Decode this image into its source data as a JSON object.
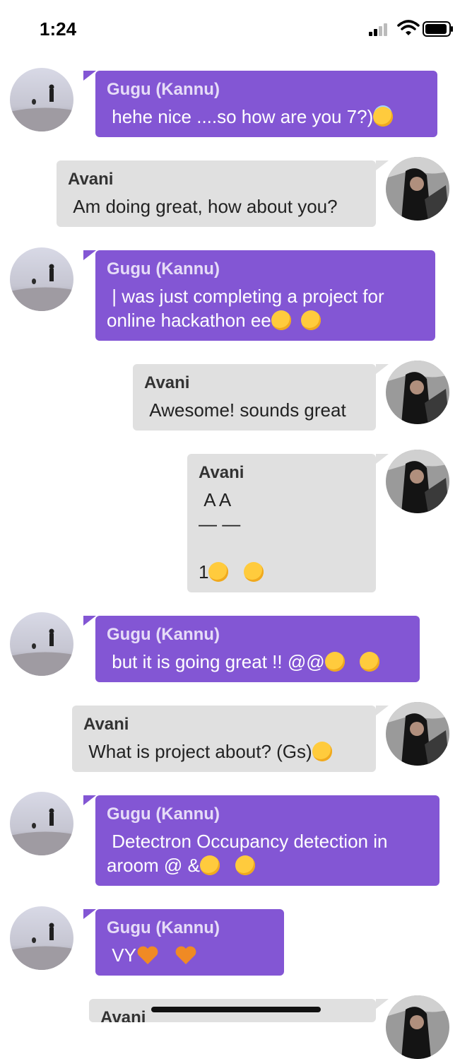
{
  "status_bar": {
    "time": "1:24"
  },
  "chat": {
    "messages": [
      {
        "sender": "Gugu (Kannu)",
        "text": " hehe nice ....so how are you 7?)",
        "emojis": [
          "halo-face"
        ]
      },
      {
        "sender": "Avani",
        "text": " Am doing great, how about you?",
        "emojis": []
      },
      {
        "sender": "Gugu (Kannu)",
        "text": " | was just completing a project for\nonline hackathon ee",
        "emojis": [
          "grimace-face",
          "grimace-face"
        ]
      },
      {
        "sender": "Avani",
        "text": " Awesome! sounds great",
        "emojis": []
      },
      {
        "sender": "Avani",
        "text": " A A\n— —\n\n1",
        "emojis": [
          "smile-face",
          "smile-face"
        ]
      },
      {
        "sender": "Gugu (Kannu)",
        "text": " but it is going great !! @@",
        "emojis": [
          "heart-eyes-face",
          "kissing-face"
        ]
      },
      {
        "sender": "Avani",
        "text": " What is project about? (Gs)",
        "emojis": [
          "surprised-face"
        ]
      },
      {
        "sender": "Gugu (Kannu)",
        "text": " Detectron Occupancy detection in\naroom @ &",
        "emojis": [
          "heart-eyes-face",
          "relieved-face"
        ]
      },
      {
        "sender": "Gugu (Kannu)",
        "text": " VY",
        "emojis": [
          "orange-heart",
          "orange-heart"
        ]
      },
      {
        "sender": "Avani",
        "text": "",
        "emojis": []
      }
    ]
  },
  "colors": {
    "gugu_bubble": "#8356d4",
    "avani_bubble": "#e0e0e0"
  }
}
